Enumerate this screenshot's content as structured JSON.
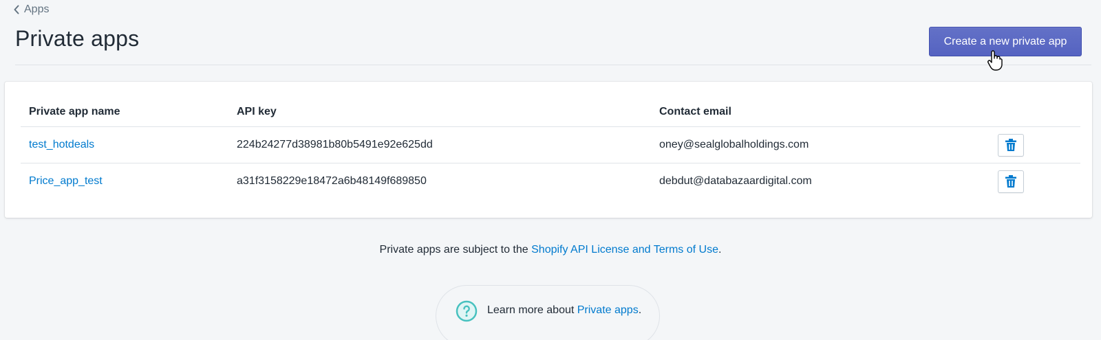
{
  "breadcrumb": {
    "label": "Apps"
  },
  "header": {
    "title": "Private apps",
    "create_button_label": "Create a new private app"
  },
  "table": {
    "columns": [
      "Private app name",
      "API key",
      "Contact email",
      ""
    ],
    "rows": [
      {
        "name": "test_hotdeals",
        "api_key": "224b24277d38981b80b5491e92e625dd",
        "email": "oney@sealglobalholdings.com"
      },
      {
        "name": "Price_app_test",
        "api_key": "a31f3158229e18472a6b48149f689850",
        "email": "debdut@databazaardigital.com"
      }
    ]
  },
  "footer": {
    "prefix": "Private apps are subject to the ",
    "link_label": "Shopify API License and Terms of Use",
    "suffix": "."
  },
  "help": {
    "prefix": "Learn more about ",
    "link_label": "Private apps",
    "suffix": "."
  },
  "icons": {
    "back": "chevron-left-icon",
    "delete": "trash-icon",
    "help": "question-circle-icon",
    "cursor": "hand-pointer-icon"
  },
  "colors": {
    "primary": "#5c6ac4",
    "link": "#007ace",
    "help_icon": "#47c1bf"
  }
}
